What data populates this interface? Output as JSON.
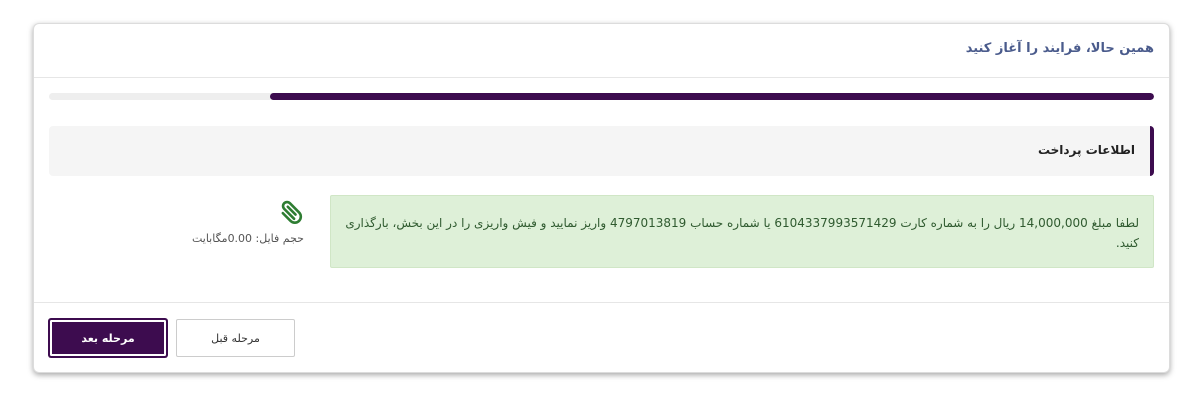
{
  "header": {
    "title": "همین حالا، فرایند را آغاز کنید"
  },
  "progress": {
    "fraction": 0.8
  },
  "section": {
    "title": "اطلاعات پرداخت"
  },
  "payment": {
    "instruction": "لطفا مبلغ 14,000,000 ریال را به شماره کارت 6104337993571429 یا شماره حساب 4797013819 واریز نمایید و فیش واریزی را در این بخش، بارگذاری کنید."
  },
  "attachment": {
    "icon": "paperclip-icon",
    "file_size_label": "حجم فایل: 0.00مگابایت"
  },
  "footer": {
    "next_label": "مرحله بعد",
    "prev_label": "مرحله قبل"
  },
  "colors": {
    "accent": "#3d0c4f",
    "title": "#4a5b8c",
    "alert_bg": "#def0d8",
    "icon": "#2e7d32"
  }
}
